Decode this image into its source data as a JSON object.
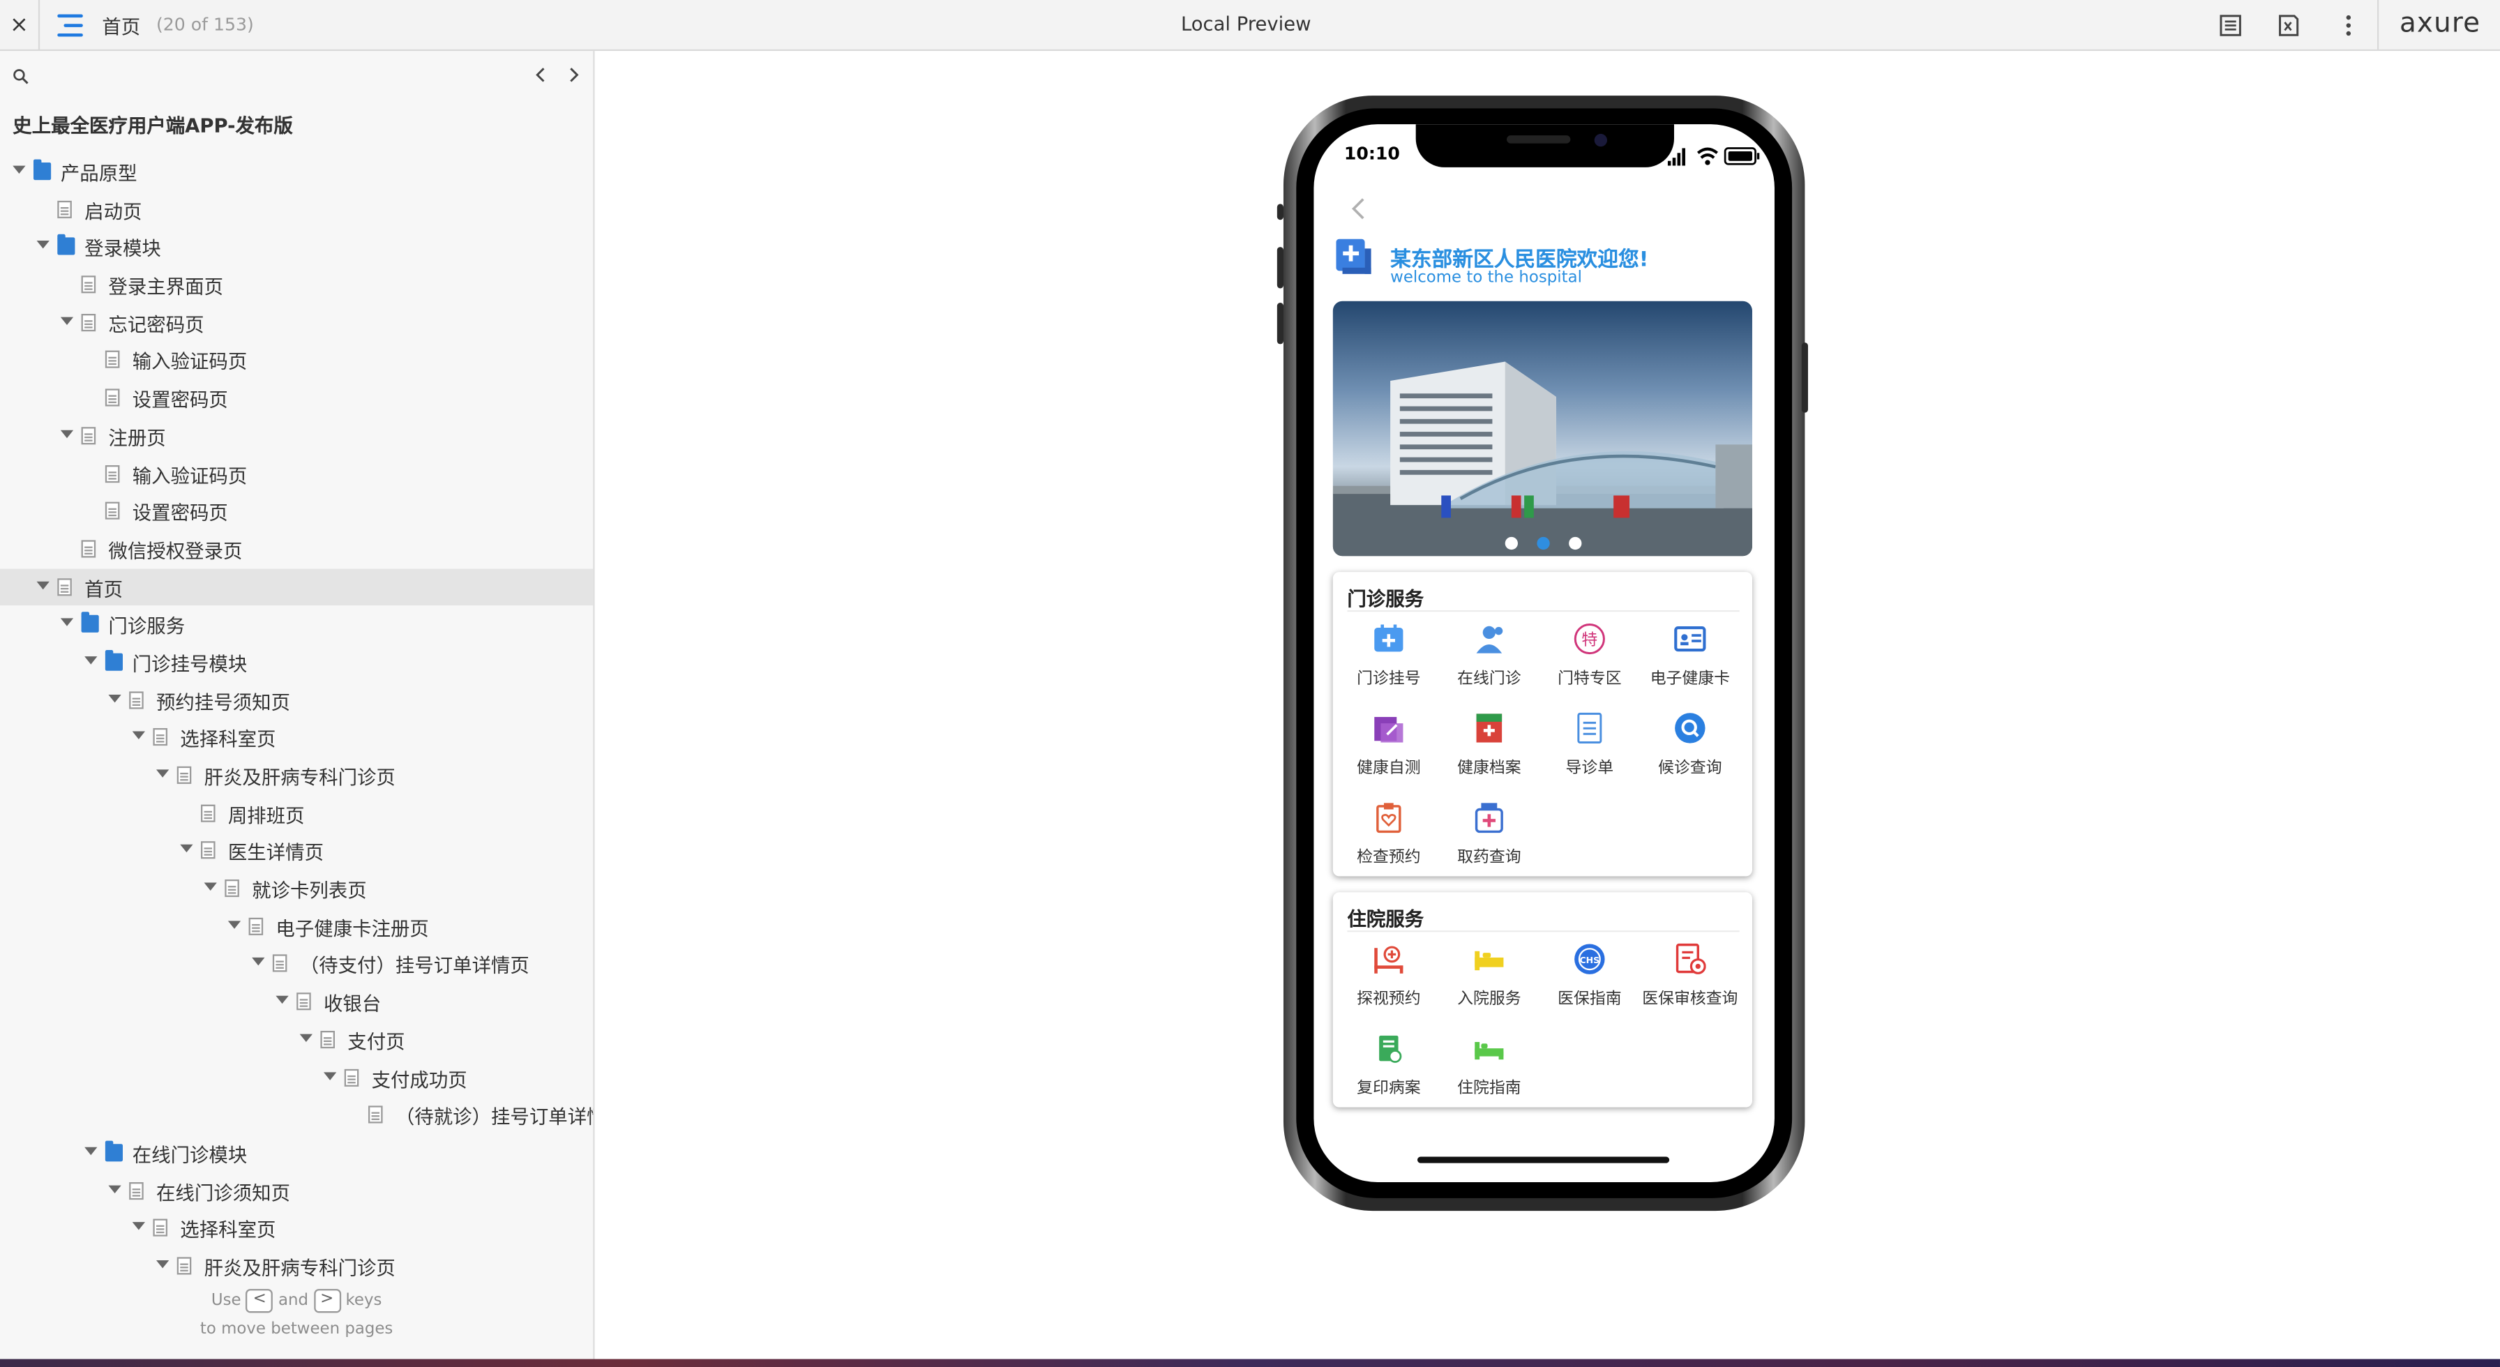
{
  "topbar": {
    "close": "×",
    "page_title": "首页",
    "page_count": "(20 of 153)",
    "center_title": "Local Preview",
    "brand": "axure"
  },
  "sidebar": {
    "project_title": "史上最全医疗用户端APP-发布版",
    "tree": [
      {
        "label": "产品原型",
        "type": "folder",
        "level": 0,
        "expanded": true
      },
      {
        "label": "启动页",
        "type": "page",
        "level": 1
      },
      {
        "label": "登录模块",
        "type": "folder",
        "level": 1,
        "expanded": true
      },
      {
        "label": "登录主界面页",
        "type": "page",
        "level": 2
      },
      {
        "label": "忘记密码页",
        "type": "page",
        "level": 2,
        "expanded": true
      },
      {
        "label": "输入验证码页",
        "type": "page",
        "level": 3
      },
      {
        "label": "设置密码页",
        "type": "page",
        "level": 3
      },
      {
        "label": "注册页",
        "type": "page",
        "level": 2,
        "expanded": true
      },
      {
        "label": "输入验证码页",
        "type": "page",
        "level": 3
      },
      {
        "label": "设置密码页",
        "type": "page",
        "level": 3
      },
      {
        "label": "微信授权登录页",
        "type": "page",
        "level": 2
      },
      {
        "label": "首页",
        "type": "page",
        "level": 1,
        "expanded": true,
        "selected": true
      },
      {
        "label": "门诊服务",
        "type": "folder",
        "level": 2,
        "expanded": true
      },
      {
        "label": "门诊挂号模块",
        "type": "folder",
        "level": 3,
        "expanded": true
      },
      {
        "label": "预约挂号须知页",
        "type": "page",
        "level": 4,
        "expanded": true
      },
      {
        "label": "选择科室页",
        "type": "page",
        "level": 5,
        "expanded": true
      },
      {
        "label": "肝炎及肝病专科门诊页",
        "type": "page",
        "level": 6,
        "expanded": true
      },
      {
        "label": "周排班页",
        "type": "page",
        "level": 7
      },
      {
        "label": "医生详情页",
        "type": "page",
        "level": 7,
        "expanded": true
      },
      {
        "label": "就诊卡列表页",
        "type": "page",
        "level": 8,
        "expanded": true
      },
      {
        "label": "电子健康卡注册页",
        "type": "page",
        "level": 9,
        "expanded": true
      },
      {
        "label": "（待支付）挂号订单详情页",
        "type": "page",
        "level": 10,
        "expanded": true
      },
      {
        "label": "收银台",
        "type": "page",
        "level": 11,
        "expanded": true
      },
      {
        "label": "支付页",
        "type": "page",
        "level": 12,
        "expanded": true
      },
      {
        "label": "支付成功页",
        "type": "page",
        "level": 13,
        "expanded": true
      },
      {
        "label": "（待就诊）挂号订单详情页",
        "type": "page",
        "level": 14
      },
      {
        "label": "在线门诊模块",
        "type": "folder",
        "level": 3,
        "expanded": true
      },
      {
        "label": "在线门诊须知页",
        "type": "page",
        "level": 4,
        "expanded": true
      },
      {
        "label": "选择科室页",
        "type": "page",
        "level": 5,
        "expanded": true
      },
      {
        "label": "肝炎及肝病专科门诊页",
        "type": "page",
        "level": 6,
        "expanded": true
      }
    ],
    "hint": {
      "use": "Use",
      "and": "and",
      "keys": "keys",
      "line2": "to move between pages",
      "prev_key": "<",
      "next_key": ">"
    }
  },
  "phone": {
    "time": "10:10",
    "hospital_name": "某东部新区人民医院欢迎您!",
    "hospital_sub": "welcome to the hospital",
    "carousel_active_index": 1,
    "outpatient": {
      "title": "门诊服务",
      "items": [
        {
          "label": "门诊挂号",
          "icon": "calendar-plus-icon",
          "color": "#4a9af0"
        },
        {
          "label": "在线门诊",
          "icon": "doctor-icon",
          "color": "#4a8fe0"
        },
        {
          "label": "门特专区",
          "icon": "special-circle-icon",
          "color": "#d0357a",
          "glyph": "特"
        },
        {
          "label": "电子健康卡",
          "icon": "id-card-icon",
          "color": "#2f6fd0"
        },
        {
          "label": "健康自测",
          "icon": "self-test-icon",
          "color": "#8a3fb8"
        },
        {
          "label": "健康档案",
          "icon": "health-record-icon",
          "color": "#d9423a"
        },
        {
          "label": "导诊单",
          "icon": "guide-list-icon",
          "color": "#4a8fe0"
        },
        {
          "label": "候诊查询",
          "icon": "queue-search-icon",
          "color": "#2a7fe0"
        },
        {
          "label": "检查预约",
          "icon": "clipboard-heart-icon",
          "color": "#e0603a"
        },
        {
          "label": "取药查询",
          "icon": "medicine-icon",
          "color": "#3a6fd0"
        }
      ]
    },
    "inpatient": {
      "title": "住院服务",
      "items": [
        {
          "label": "探视预约",
          "icon": "bed-plus-icon",
          "color": "#e04a3a"
        },
        {
          "label": "入院服务",
          "icon": "admission-bed-icon",
          "color": "#f0d020"
        },
        {
          "label": "医保指南",
          "icon": "insurance-icon",
          "color": "#2a6fe0",
          "glyph": "CHS"
        },
        {
          "label": "医保审核查询",
          "icon": "insurance-audit-icon",
          "color": "#e03a3a"
        },
        {
          "label": "复印病案",
          "icon": "copy-record-icon",
          "color": "#3aaa5a"
        },
        {
          "label": "住院指南",
          "icon": "hospital-bed-icon",
          "color": "#5ac84a"
        }
      ]
    }
  }
}
